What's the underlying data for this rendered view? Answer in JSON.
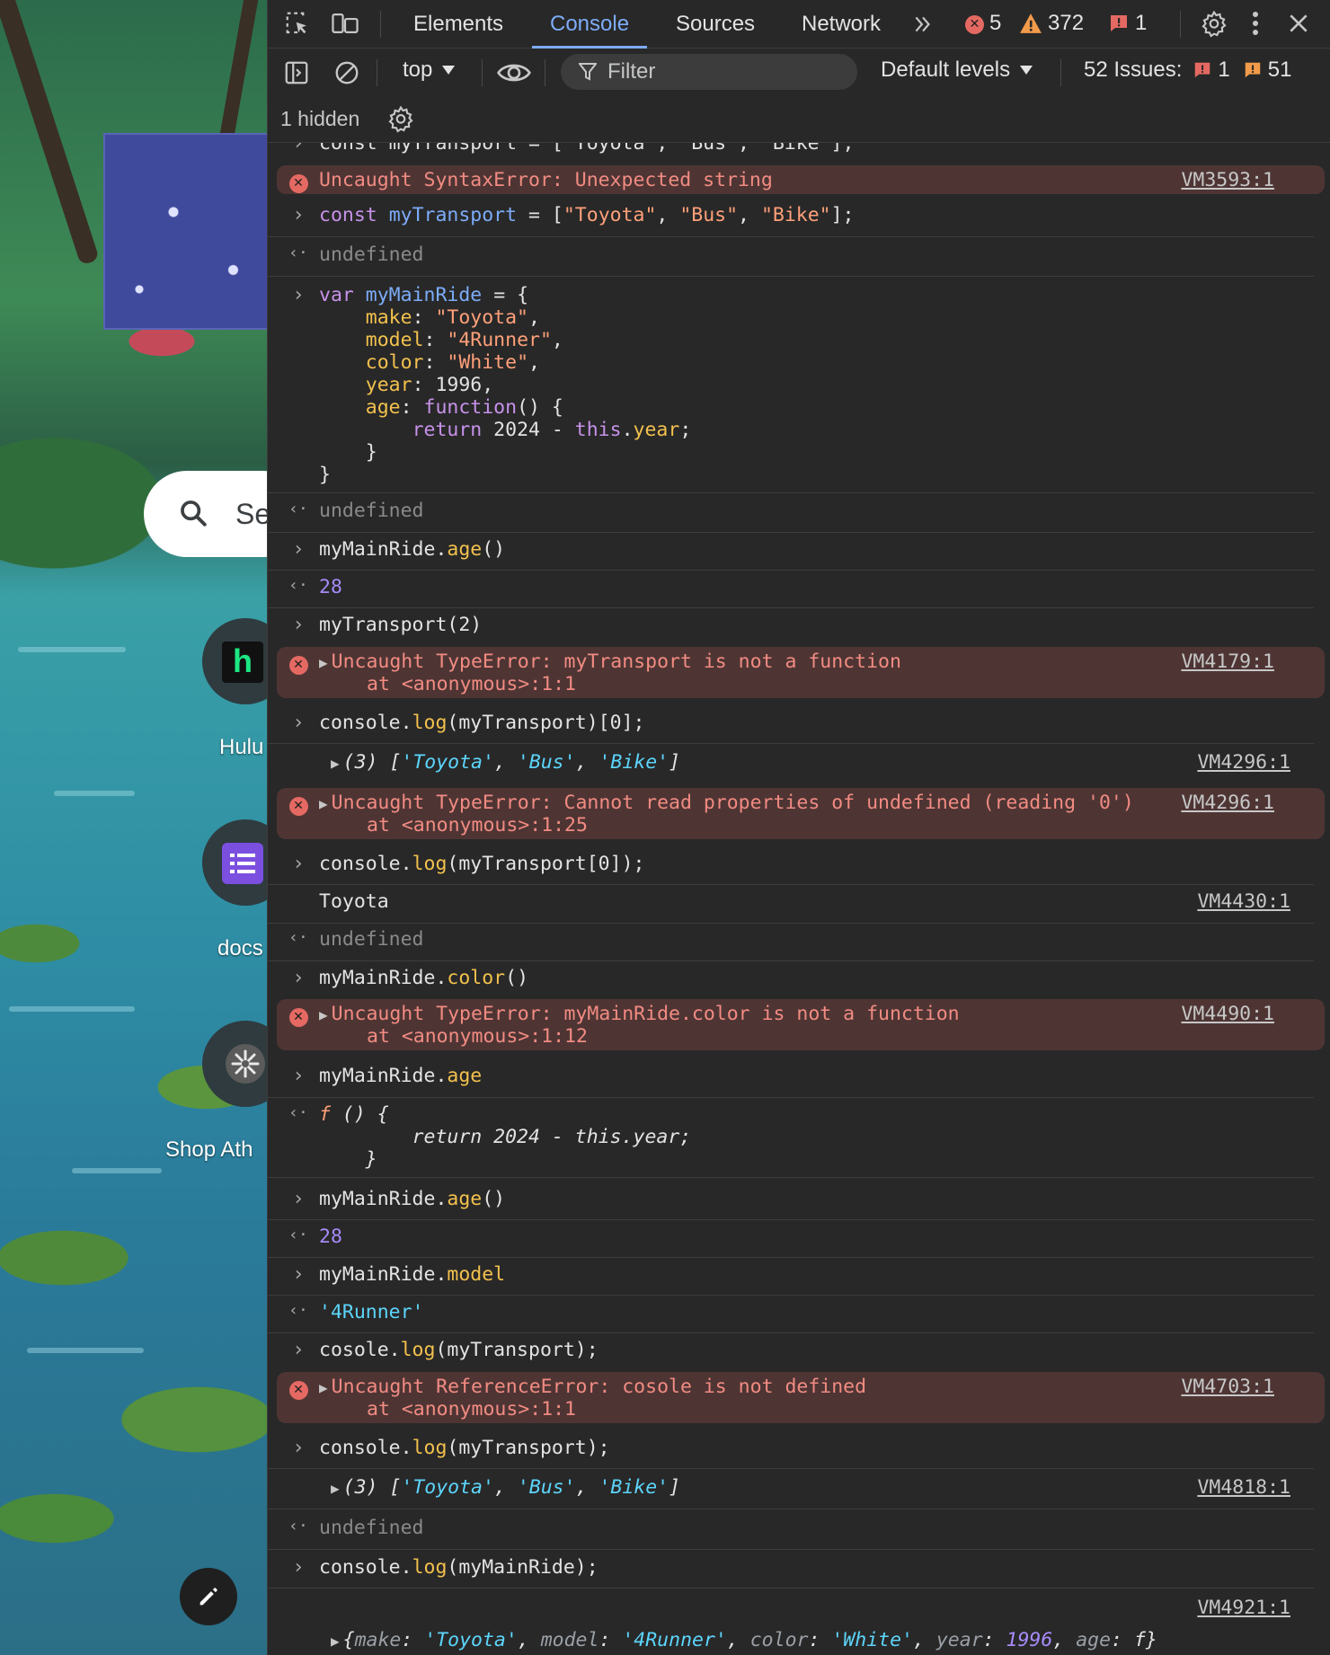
{
  "background": {
    "search_text": "Se",
    "shortcuts": [
      {
        "label": "Hulu",
        "icon": "hulu-icon"
      },
      {
        "label": "docs",
        "icon": "list-icon"
      },
      {
        "label": "Shop Ath",
        "icon": "pinwheel-icon"
      }
    ]
  },
  "devtools": {
    "tabs": [
      "Elements",
      "Console",
      "Sources",
      "Network"
    ],
    "active_tab": "Console",
    "error_count": "5",
    "warning_count": "372",
    "issue_count": "1",
    "context": "top",
    "filter_placeholder": "Filter",
    "levels": "Default levels",
    "issues_label": "52 Issues:",
    "issues_errors": "1",
    "issues_warnings": "51",
    "hidden_label": "1 hidden",
    "accent_color": "#7cacf8",
    "error_bg": "#4e3534"
  },
  "console": {
    "partial_line": "const myTransport = [\"Toyota\", \"Bus\", \"Bike\"];",
    "e1_text": "Uncaught SyntaxError: Unexpected string",
    "e1_src": "VM3593:1",
    "in1": "const myTransport = [\"Toyota\", \"Bus\", \"Bike\"];",
    "undefined": "undefined",
    "in3_call": "myMainRide.age()",
    "out_28": "28",
    "in4": "myTransport(2)",
    "e2_text": "Uncaught TypeError: myTransport is not a function",
    "e2_stack": "at <anonymous>:1:1",
    "e2_src": "VM4179:1",
    "in5": "console.log(myTransport)[0];",
    "log1_src": "VM4296:1",
    "e3_text": "Uncaught TypeError: Cannot read properties of undefined (reading '0')",
    "e3_stack": "at <anonymous>:1:25",
    "e3_src": "VM4296:1",
    "in6": "console.log(myTransport[0]);",
    "log2_text": "Toyota",
    "log2_src": "VM4430:1",
    "in7": "myMainRide.color()",
    "e4_text": "Uncaught TypeError: myMainRide.color is not a function",
    "e4_stack": "at <anonymous>:1:12",
    "e4_src": "VM4490:1",
    "in8": "myMainRide.age",
    "in10": "myMainRide.model",
    "out_model": "'4Runner'",
    "in11": "cosole.log(myTransport);",
    "e5_text": "Uncaught ReferenceError: cosole is not defined",
    "e5_stack": "at <anonymous>:1:1",
    "e5_src": "VM4703:1",
    "in12": "console.log(myTransport);",
    "log3_src": "VM4818:1",
    "in13": "console.log(myMainRide);",
    "log4_src": "VM4921:1"
  }
}
